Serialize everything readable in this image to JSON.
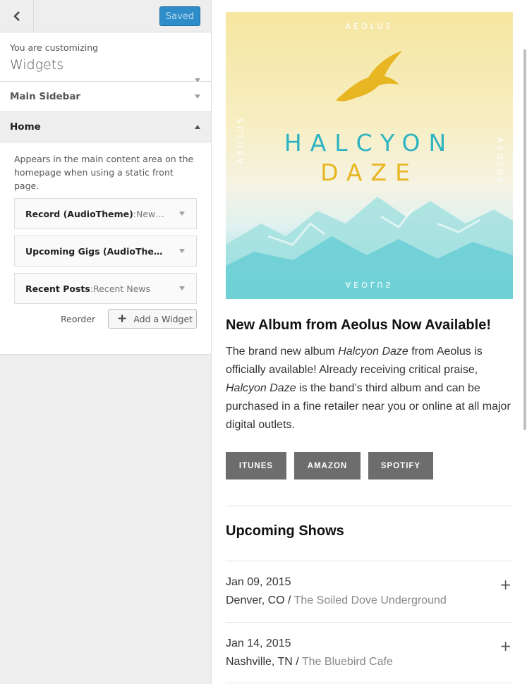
{
  "customizer": {
    "saved_label": "Saved",
    "info_sub": "You are customizing",
    "info_title": "Widgets",
    "sections": [
      "Main Sidebar",
      "Home"
    ],
    "area_description": "Appears in the main content area on the homepage when using a static front page.",
    "widgets": [
      {
        "name": "Record (AudioTheme)",
        "sep": ": ",
        "sub": "New…"
      },
      {
        "name": "Upcoming Gigs (AudioThe…",
        "sep": "",
        "sub": ""
      },
      {
        "name": "Recent Posts",
        "sep": ": ",
        "sub": "Recent News"
      }
    ],
    "reorder_label": "Reorder",
    "add_widget_label": "Add a Widget"
  },
  "preview": {
    "cover": {
      "brand": "AEOLUS",
      "title_line1": "HALCYON",
      "title_line2": "DAZE"
    },
    "post_title": "New Album from Aeolus Now Available!",
    "post_body": {
      "t1": "The brand new album ",
      "e1": "Halcyon Daze",
      "t2": " from Aeolus is officially available! Already receiving critical praise, ",
      "e2": "Halcyon Daze",
      "t3": " is the band’s third album and can be purchased in a fine retailer near you or online at all major digital outlets."
    },
    "buttons": [
      "ITUNES",
      "AMAZON",
      "SPOTIFY"
    ],
    "shows_title": "Upcoming Shows",
    "gigs": [
      {
        "date": "Jan 09, 2015",
        "city": "Denver, CO",
        "sep": " / ",
        "venue": "The Soiled Dove Underground"
      },
      {
        "date": "Jan 14, 2015",
        "city": "Nashville, TN",
        "sep": " / ",
        "venue": "The Bluebird Cafe"
      }
    ]
  },
  "colors": {
    "saved_button": "#2e8cc8",
    "store_button": "#6d6d6d",
    "title_teal": "#2db3c1",
    "title_gold": "#e8b623"
  },
  "icons": [
    "back-arrow-icon",
    "caret-down-icon",
    "caret-up-icon",
    "plus-icon",
    "eagle-icon",
    "expand-plus-icon"
  ]
}
